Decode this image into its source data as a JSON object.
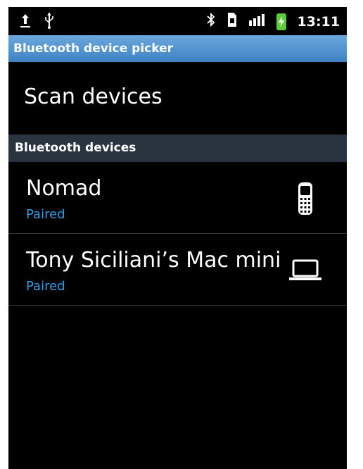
{
  "status_bar": {
    "left_icons": [
      "upload-icon",
      "usb-icon"
    ],
    "right_icons": [
      "bluetooth-icon",
      "sim-icon",
      "signal-icon",
      "battery-charging-icon"
    ],
    "time": "13:11"
  },
  "title_bar": {
    "title": "Bluetooth device picker"
  },
  "scan": {
    "label": "Scan devices"
  },
  "section": {
    "title": "Bluetooth devices"
  },
  "devices": [
    {
      "name": "Nomad",
      "status": "Paired",
      "icon": "phone-icon"
    },
    {
      "name": "Tony Siciliani’s Mac mini",
      "status": "Paired",
      "icon": "laptop-icon"
    }
  ],
  "colors": {
    "background": "#000000",
    "title_bar": "#4a8fd0",
    "section_header": "#2a3440",
    "paired_status": "#2f9de6",
    "battery": "#5ecb3a"
  }
}
